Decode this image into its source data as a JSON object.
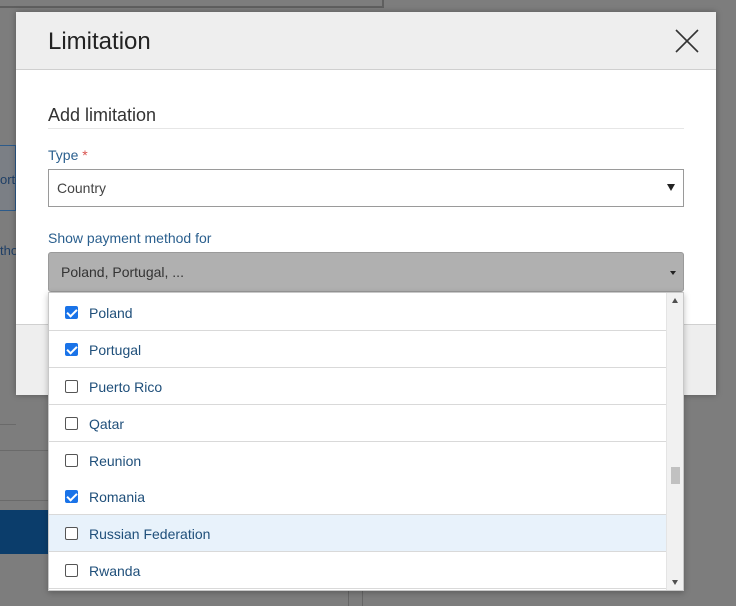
{
  "background": {
    "fragment_1": "orte",
    "fragment_2": "tho"
  },
  "modal": {
    "title": "Limitation",
    "close_icon": "close-icon",
    "section_title": "Add limitation",
    "type_field": {
      "label": "Type",
      "required_mark": "*",
      "value": "Country"
    },
    "payment_field": {
      "label": "Show payment method for",
      "value": "Poland, Portugal, ..."
    }
  },
  "dropdown": {
    "options": [
      {
        "label": "Poland",
        "checked": true
      },
      {
        "label": "Portugal",
        "checked": true
      },
      {
        "label": "Puerto Rico",
        "checked": false
      },
      {
        "label": "Qatar",
        "checked": false
      },
      {
        "label": "Reunion",
        "checked": false
      },
      {
        "label": "Romania",
        "checked": true
      },
      {
        "label": "Russian Federation",
        "checked": false,
        "highlighted": true
      },
      {
        "label": "Rwanda",
        "checked": false
      }
    ],
    "scroll_position": 0.65
  },
  "colors": {
    "accent": "#1a73e8",
    "label_blue": "#2a5f8e",
    "highlight_row": "#e8f2fb",
    "required": "#d9534f"
  }
}
